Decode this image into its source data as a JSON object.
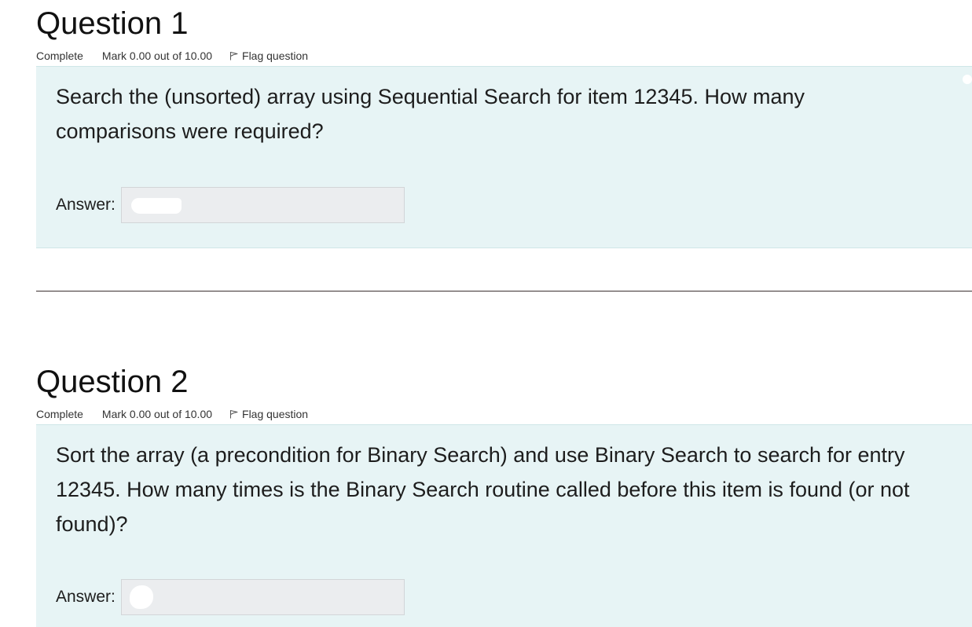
{
  "questions": [
    {
      "title": "Question 1",
      "state": "Complete",
      "grade": "Mark 0.00 out of 10.00",
      "flag_label": "Flag question",
      "text": "Search the (unsorted) array using Sequential Search for item 12345. How many comparisons were required?",
      "answer_label": "Answer:"
    },
    {
      "title": "Question 2",
      "state": "Complete",
      "grade": "Mark 0.00 out of 10.00",
      "flag_label": "Flag question",
      "text": "Sort the array (a precondition for Binary Search) and use Binary Search to search for entry 12345. How many times is the Binary Search routine called before this item is found (or not found)?",
      "answer_label": "Answer:"
    }
  ],
  "icons": {
    "flag": "flag-icon"
  },
  "colors": {
    "formulation_bg": "#e7f4f5",
    "answer_bg": "#ebedef",
    "divider": "#3b3030"
  }
}
